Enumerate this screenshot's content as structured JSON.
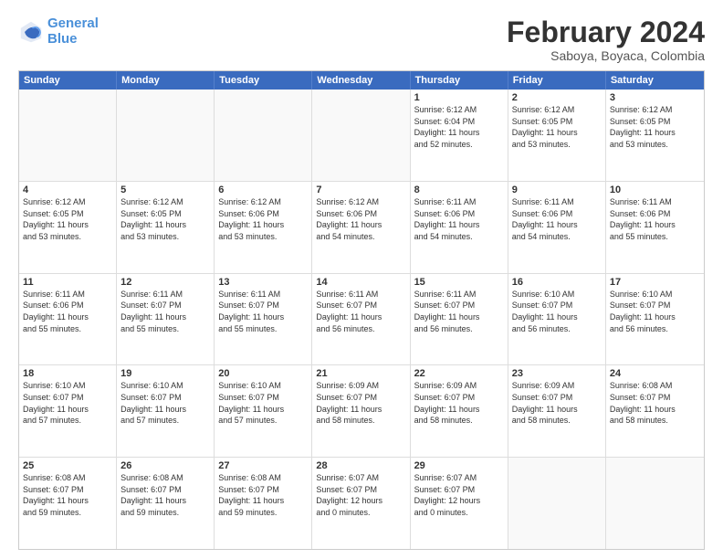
{
  "header": {
    "logo_line1": "General",
    "logo_line2": "Blue",
    "title": "February 2024",
    "subtitle": "Saboya, Boyaca, Colombia"
  },
  "weekdays": [
    "Sunday",
    "Monday",
    "Tuesday",
    "Wednesday",
    "Thursday",
    "Friday",
    "Saturday"
  ],
  "rows": [
    [
      {
        "day": "",
        "info": ""
      },
      {
        "day": "",
        "info": ""
      },
      {
        "day": "",
        "info": ""
      },
      {
        "day": "",
        "info": ""
      },
      {
        "day": "1",
        "info": "Sunrise: 6:12 AM\nSunset: 6:04 PM\nDaylight: 11 hours\nand 52 minutes."
      },
      {
        "day": "2",
        "info": "Sunrise: 6:12 AM\nSunset: 6:05 PM\nDaylight: 11 hours\nand 53 minutes."
      },
      {
        "day": "3",
        "info": "Sunrise: 6:12 AM\nSunset: 6:05 PM\nDaylight: 11 hours\nand 53 minutes."
      }
    ],
    [
      {
        "day": "4",
        "info": "Sunrise: 6:12 AM\nSunset: 6:05 PM\nDaylight: 11 hours\nand 53 minutes."
      },
      {
        "day": "5",
        "info": "Sunrise: 6:12 AM\nSunset: 6:05 PM\nDaylight: 11 hours\nand 53 minutes."
      },
      {
        "day": "6",
        "info": "Sunrise: 6:12 AM\nSunset: 6:06 PM\nDaylight: 11 hours\nand 53 minutes."
      },
      {
        "day": "7",
        "info": "Sunrise: 6:12 AM\nSunset: 6:06 PM\nDaylight: 11 hours\nand 54 minutes."
      },
      {
        "day": "8",
        "info": "Sunrise: 6:11 AM\nSunset: 6:06 PM\nDaylight: 11 hours\nand 54 minutes."
      },
      {
        "day": "9",
        "info": "Sunrise: 6:11 AM\nSunset: 6:06 PM\nDaylight: 11 hours\nand 54 minutes."
      },
      {
        "day": "10",
        "info": "Sunrise: 6:11 AM\nSunset: 6:06 PM\nDaylight: 11 hours\nand 55 minutes."
      }
    ],
    [
      {
        "day": "11",
        "info": "Sunrise: 6:11 AM\nSunset: 6:06 PM\nDaylight: 11 hours\nand 55 minutes."
      },
      {
        "day": "12",
        "info": "Sunrise: 6:11 AM\nSunset: 6:07 PM\nDaylight: 11 hours\nand 55 minutes."
      },
      {
        "day": "13",
        "info": "Sunrise: 6:11 AM\nSunset: 6:07 PM\nDaylight: 11 hours\nand 55 minutes."
      },
      {
        "day": "14",
        "info": "Sunrise: 6:11 AM\nSunset: 6:07 PM\nDaylight: 11 hours\nand 56 minutes."
      },
      {
        "day": "15",
        "info": "Sunrise: 6:11 AM\nSunset: 6:07 PM\nDaylight: 11 hours\nand 56 minutes."
      },
      {
        "day": "16",
        "info": "Sunrise: 6:10 AM\nSunset: 6:07 PM\nDaylight: 11 hours\nand 56 minutes."
      },
      {
        "day": "17",
        "info": "Sunrise: 6:10 AM\nSunset: 6:07 PM\nDaylight: 11 hours\nand 56 minutes."
      }
    ],
    [
      {
        "day": "18",
        "info": "Sunrise: 6:10 AM\nSunset: 6:07 PM\nDaylight: 11 hours\nand 57 minutes."
      },
      {
        "day": "19",
        "info": "Sunrise: 6:10 AM\nSunset: 6:07 PM\nDaylight: 11 hours\nand 57 minutes."
      },
      {
        "day": "20",
        "info": "Sunrise: 6:10 AM\nSunset: 6:07 PM\nDaylight: 11 hours\nand 57 minutes."
      },
      {
        "day": "21",
        "info": "Sunrise: 6:09 AM\nSunset: 6:07 PM\nDaylight: 11 hours\nand 58 minutes."
      },
      {
        "day": "22",
        "info": "Sunrise: 6:09 AM\nSunset: 6:07 PM\nDaylight: 11 hours\nand 58 minutes."
      },
      {
        "day": "23",
        "info": "Sunrise: 6:09 AM\nSunset: 6:07 PM\nDaylight: 11 hours\nand 58 minutes."
      },
      {
        "day": "24",
        "info": "Sunrise: 6:08 AM\nSunset: 6:07 PM\nDaylight: 11 hours\nand 58 minutes."
      }
    ],
    [
      {
        "day": "25",
        "info": "Sunrise: 6:08 AM\nSunset: 6:07 PM\nDaylight: 11 hours\nand 59 minutes."
      },
      {
        "day": "26",
        "info": "Sunrise: 6:08 AM\nSunset: 6:07 PM\nDaylight: 11 hours\nand 59 minutes."
      },
      {
        "day": "27",
        "info": "Sunrise: 6:08 AM\nSunset: 6:07 PM\nDaylight: 11 hours\nand 59 minutes."
      },
      {
        "day": "28",
        "info": "Sunrise: 6:07 AM\nSunset: 6:07 PM\nDaylight: 12 hours\nand 0 minutes."
      },
      {
        "day": "29",
        "info": "Sunrise: 6:07 AM\nSunset: 6:07 PM\nDaylight: 12 hours\nand 0 minutes."
      },
      {
        "day": "",
        "info": ""
      },
      {
        "day": "",
        "info": ""
      }
    ]
  ]
}
